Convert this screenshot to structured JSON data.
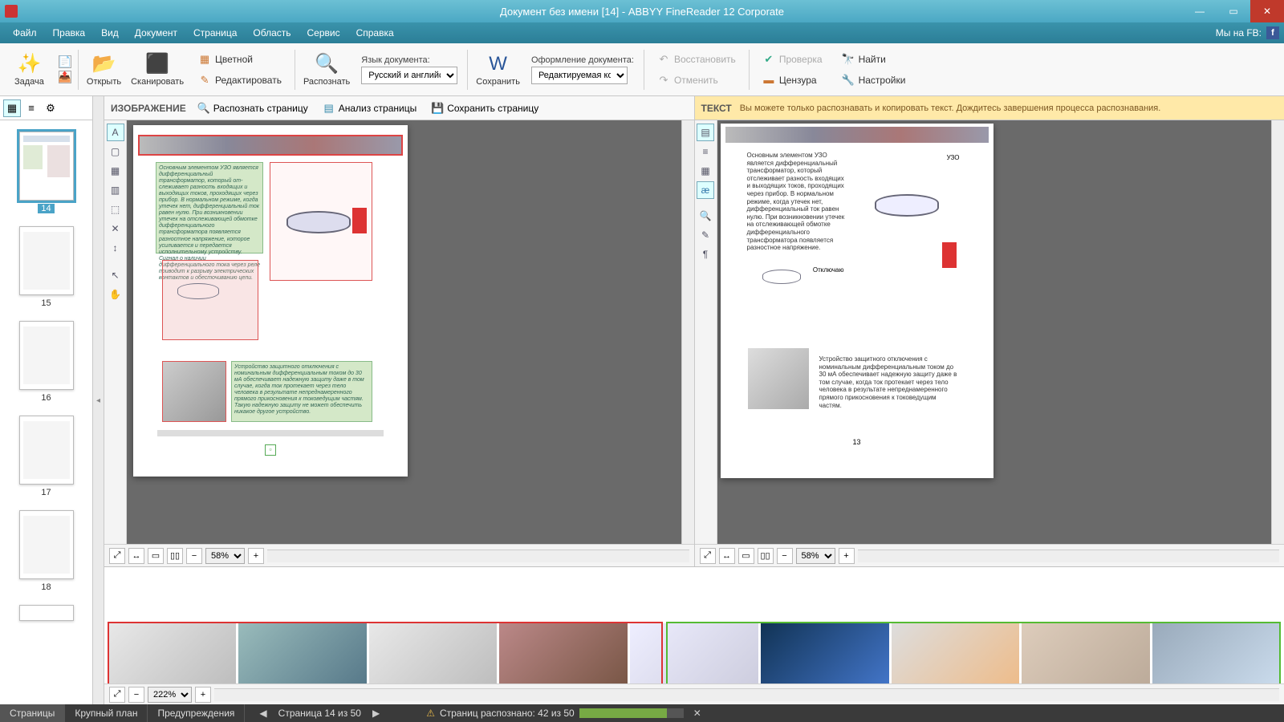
{
  "window": {
    "title": "Документ без имени [14] - ABBYY FineReader 12 Corporate"
  },
  "menu": {
    "file": "Файл",
    "edit": "Правка",
    "view": "Вид",
    "document": "Документ",
    "page": "Страница",
    "area": "Область",
    "service": "Сервис",
    "help": "Справка",
    "fb": "Мы на FB:"
  },
  "toolbar": {
    "task": "Задача",
    "open": "Открыть",
    "scan": "Сканировать",
    "color": "Цветной",
    "editimg": "Редактировать",
    "read": "Распознать",
    "lang_label": "Язык документа:",
    "lang_value": "Русский и английский",
    "save": "Сохранить",
    "layout_label": "Оформление документа:",
    "layout_value": "Редактируемая копия",
    "restore": "Восстановить",
    "cancel": "Отменить",
    "verify": "Проверка",
    "censor": "Цензура",
    "find": "Найти",
    "settings": "Настройки"
  },
  "imgpane": {
    "title": "ИЗОБРАЖЕНИЕ",
    "read_page": "Распознать страницу",
    "analyze": "Анализ страницы",
    "save_page": "Сохранить страницу",
    "zoom": "58%"
  },
  "txtpane": {
    "title": "ТЕКСТ",
    "msg": "Вы можете только распознавать и копировать текст. Дождитесь завершения процесса распознавания.",
    "zoom": "58%"
  },
  "closeup": {
    "zoom": "222%"
  },
  "thumbs": {
    "n14": "14",
    "n15": "15",
    "n16": "16",
    "n17": "17",
    "n18": "18"
  },
  "status": {
    "pages": "Страницы",
    "closeup": "Крупный план",
    "warn": "Предупреждения",
    "pageof": "Страница 14 из 50",
    "recog": "Страниц распознано: 42 из 50"
  },
  "content": {
    "t1": "Основным элементом УЗО является диф­ференциальный трансформатор, который от­слеживает разность входящих и выходящих токов, проходящих через прибор. В нормаль­ном режиме, когда утечек нет, дифференци­альный ток равен нулю. При возникновении утечек на отслеживающей обмотке диффе­ренциального трансформатора появляется разностное напряжение, которое усиливает­ся и передается исполнительному устрой­ству. Сигнал о наличии дифференциального тока через реле приводит к разрыву электри­ческих контактов и обесточиванию цепи.",
    "t2": "Устройство защитного отключения с номинальным дифференциальным током до 30 мА обеспечивает надежную защиту даже в том случае, когда ток протекает через тело человека в результате непред­намеренного прямого прикосновения к токоведу­щим частям. Такую надежную защиту не может обеспечить никакое другое устройство.",
    "r1": "Основным элементом УЗО является дифференциальный трансформатор, который отслеживает разность входящих и выходящих токов, проходящих через прибор. В нормальном режиме, когда утечек нет, дифференциальный ток равен нулю. При возникновении утечек на отслеживающей обмотке дифференциального трансформатора появляется разностное напряжение.",
    "r2": "Устройство защитного отключения с номинальным дифференциальным током до 30 мА обеспечивает надежную защиту даже в том случае, когда ток протекает через тело человека в результате непреднамеренного прямого прикосновения к токоведущим частям.",
    "pgnum": "13",
    "off": "Отключаю",
    "uzo": "УЗО"
  }
}
